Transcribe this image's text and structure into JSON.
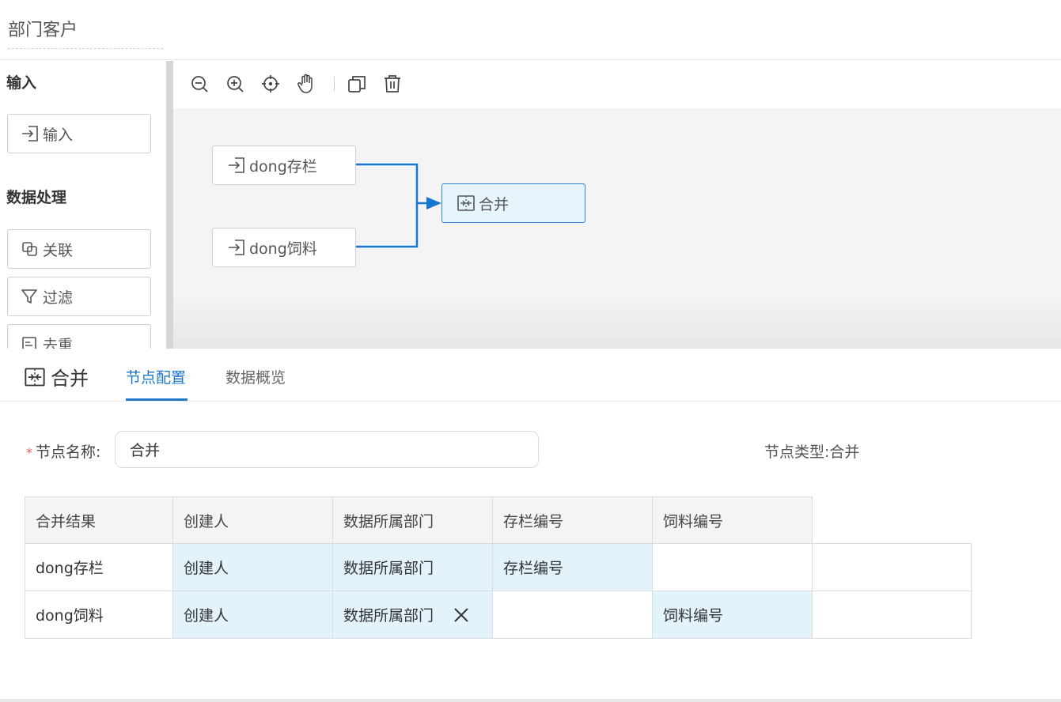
{
  "header": {
    "title": "部门客户"
  },
  "sidebar": {
    "sections": [
      {
        "title": "输入",
        "items": [
          {
            "label": "输入",
            "icon": "input-arrow-icon"
          }
        ]
      },
      {
        "title": "数据处理",
        "items": [
          {
            "label": "关联",
            "icon": "join-icon"
          },
          {
            "label": "过滤",
            "icon": "filter-icon"
          },
          {
            "label": "去重",
            "icon": "dedupe-icon"
          }
        ]
      }
    ]
  },
  "toolbar": {
    "tools": [
      {
        "name": "zoom-out",
        "icon": "zoom-out-icon"
      },
      {
        "name": "zoom-in",
        "icon": "zoom-in-icon"
      },
      {
        "name": "center",
        "icon": "crosshair-icon"
      },
      {
        "name": "pan",
        "icon": "hand-icon"
      },
      {
        "name": "copy",
        "icon": "copy-icon"
      },
      {
        "name": "delete",
        "icon": "trash-icon"
      }
    ]
  },
  "canvas": {
    "nodes": [
      {
        "label": "dong存栏",
        "icon": "input-arrow-icon"
      },
      {
        "label": "dong饲料",
        "icon": "input-arrow-icon"
      },
      {
        "label": "合并",
        "icon": "merge-icon",
        "selected": true
      }
    ],
    "edge_color": "#1677d2"
  },
  "panel": {
    "title": "合并",
    "tabs": [
      {
        "label": "节点配置",
        "active": true
      },
      {
        "label": "数据概览",
        "active": false
      }
    ],
    "form": {
      "name_label": "节点名称:",
      "name_value": "合并",
      "type_label": "节点类型:",
      "type_value": "合并"
    },
    "merge_table": {
      "headers": [
        "合并结果",
        "创建人",
        "数据所属部门",
        "存栏编号",
        "饲料编号"
      ],
      "rows": [
        {
          "source": "dong存栏",
          "cells": [
            "创建人",
            "数据所属部门",
            "存栏编号",
            ""
          ]
        },
        {
          "source": "dong饲料",
          "cells": [
            "创建人",
            "数据所属部门",
            "",
            "饲料编号"
          ]
        }
      ]
    }
  },
  "colors": {
    "accent": "#1f78c8",
    "mapped_cell": "#e3f3fc",
    "required": "#e05b5b"
  }
}
